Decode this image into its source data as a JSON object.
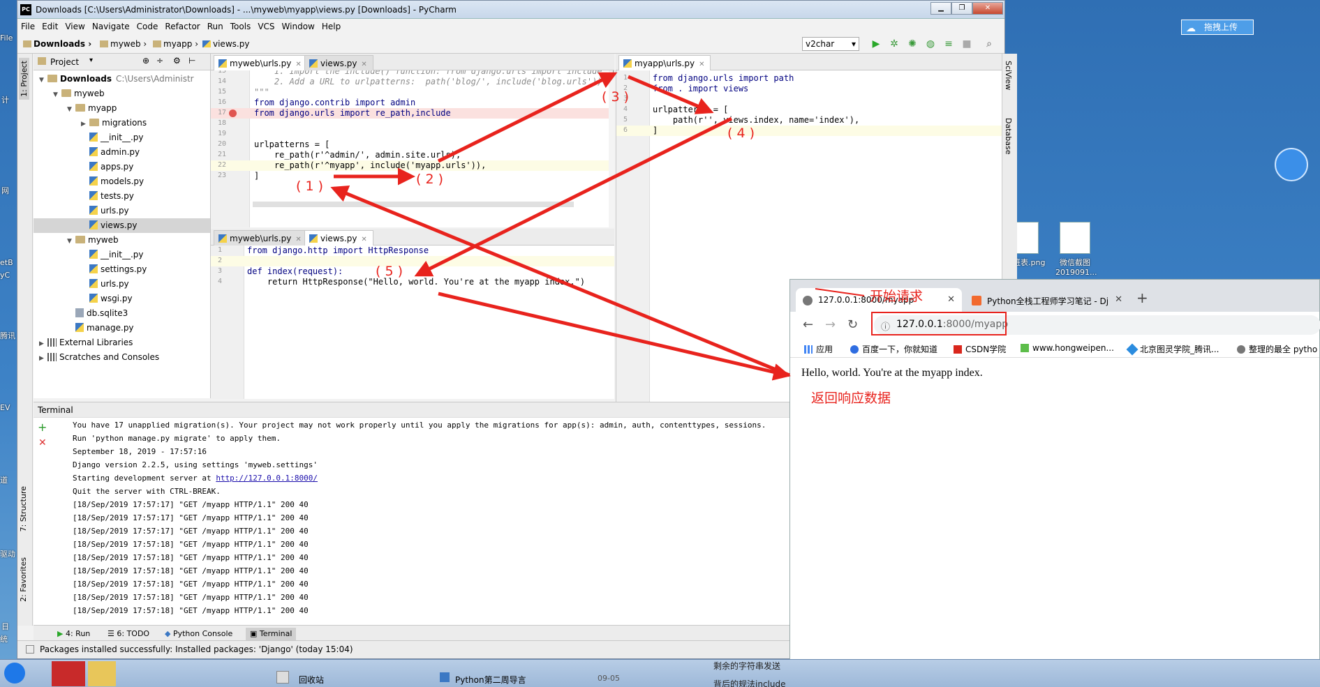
{
  "window": {
    "title": "Downloads [C:\\Users\\Administrator\\Downloads] - ...\\myweb\\myapp\\views.py [Downloads] - PyCharm",
    "logo": "PC"
  },
  "menu": [
    "File",
    "Edit",
    "View",
    "Navigate",
    "Code",
    "Refactor",
    "Run",
    "Tools",
    "VCS",
    "Window",
    "Help"
  ],
  "breadcrumbs": [
    "Downloads",
    "myweb",
    "myapp",
    "views.py"
  ],
  "run_config": "v2char",
  "left_strip": [
    "1: Project",
    "7: Structure",
    "2: Favorites"
  ],
  "project": {
    "header": "Project",
    "tree": [
      {
        "label": "Downloads",
        "extra": "C:\\Users\\Administr",
        "kind": "folder",
        "depth": 0,
        "arrow": "▼"
      },
      {
        "label": "myweb",
        "kind": "folder",
        "depth": 1,
        "arrow": "▼"
      },
      {
        "label": "myapp",
        "kind": "folder",
        "depth": 2,
        "arrow": "▼"
      },
      {
        "label": "migrations",
        "kind": "folder",
        "depth": 3,
        "arrow": "▶"
      },
      {
        "label": "__init__.py",
        "kind": "py",
        "depth": 3
      },
      {
        "label": "admin.py",
        "kind": "py",
        "depth": 3
      },
      {
        "label": "apps.py",
        "kind": "py",
        "depth": 3
      },
      {
        "label": "models.py",
        "kind": "py",
        "depth": 3
      },
      {
        "label": "tests.py",
        "kind": "py",
        "depth": 3
      },
      {
        "label": "urls.py",
        "kind": "py",
        "depth": 3
      },
      {
        "label": "views.py",
        "kind": "py",
        "depth": 3,
        "selected": true
      },
      {
        "label": "myweb",
        "kind": "folder",
        "depth": 2,
        "arrow": "▼"
      },
      {
        "label": "__init__.py",
        "kind": "py",
        "depth": 3
      },
      {
        "label": "settings.py",
        "kind": "py",
        "depth": 3
      },
      {
        "label": "urls.py",
        "kind": "py",
        "depth": 3
      },
      {
        "label": "wsgi.py",
        "kind": "py",
        "depth": 3
      },
      {
        "label": "db.sqlite3",
        "kind": "db",
        "depth": 2
      },
      {
        "label": "manage.py",
        "kind": "py",
        "depth": 2
      },
      {
        "label": "External Libraries",
        "kind": "lib",
        "depth": 0,
        "arrow": "▶"
      },
      {
        "label": "Scratches and Consoles",
        "kind": "lib",
        "depth": 0,
        "arrow": "▶"
      }
    ]
  },
  "editor_top": {
    "tabs": [
      "myweb\\urls.py",
      "views.py"
    ],
    "lines": [
      {
        "n": "13",
        "t": "    1. Import the include() function: from django.urls import include, pa",
        "c": "cmt"
      },
      {
        "n": "14",
        "t": "    2. Add a URL to urlpatterns:  path('blog/', include('blog.urls'))",
        "c": "cmt"
      },
      {
        "n": "15",
        "t": "\"\"\"",
        "c": "cmt"
      },
      {
        "n": "16",
        "t": "from django.contrib import admin",
        "c": "kw"
      },
      {
        "n": "17",
        "t": "from django.urls import re_path,include",
        "c": "kw"
      },
      {
        "n": "18",
        "t": "",
        "c": ""
      },
      {
        "n": "19",
        "t": "",
        "c": ""
      },
      {
        "n": "20",
        "t": "urlpatterns = [",
        "c": ""
      },
      {
        "n": "21",
        "t": "    re_path(r'^admin/', admin.site.urls),",
        "c": ""
      },
      {
        "n": "22",
        "t": "    re_path(r'^myapp', include('myapp.urls')),",
        "c": ""
      },
      {
        "n": "23",
        "t": "]",
        "c": ""
      }
    ]
  },
  "editor_bottom": {
    "tabs": [
      "myweb\\urls.py",
      "views.py"
    ],
    "lines": [
      {
        "n": "1",
        "t": "from django.http import HttpResponse",
        "c": "kw"
      },
      {
        "n": "2",
        "t": "",
        "c": ""
      },
      {
        "n": "3",
        "t": "def index(request):",
        "c": "kw"
      },
      {
        "n": "4",
        "t": "    return HttpResponse(\"Hello, world. You're at the myapp index.\")",
        "c": ""
      }
    ]
  },
  "editor_right": {
    "tabs": [
      "myapp\\urls.py"
    ],
    "lines": [
      {
        "n": "1",
        "t": "from django.urls import path",
        "c": "kw"
      },
      {
        "n": "2",
        "t": "from . import views",
        "c": "kw"
      },
      {
        "n": "3",
        "t": "",
        "c": ""
      },
      {
        "n": "4",
        "t": "urlpatterns = [",
        "c": ""
      },
      {
        "n": "5",
        "t": "    path(r'', views.index, name='index'),",
        "c": ""
      },
      {
        "n": "6",
        "t": "]",
        "c": ""
      }
    ]
  },
  "right_strip": [
    "SciView",
    "Database"
  ],
  "terminal": {
    "title": "Terminal",
    "lines": [
      "You have 17 unapplied migration(s). Your project may not work properly until you apply the migrations for app(s): admin, auth, contenttypes, sessions.",
      "Run 'python manage.py migrate' to apply them.",
      "September 18, 2019 - 17:57:16",
      "Django version 2.2.5, using settings 'myweb.settings'",
      "Starting development server at ",
      "Quit the server with CTRL-BREAK.",
      "[18/Sep/2019 17:57:17] \"GET /myapp HTTP/1.1\" 200 40",
      "[18/Sep/2019 17:57:17] \"GET /myapp HTTP/1.1\" 200 40",
      "[18/Sep/2019 17:57:17] \"GET /myapp HTTP/1.1\" 200 40",
      "[18/Sep/2019 17:57:18] \"GET /myapp HTTP/1.1\" 200 40",
      "[18/Sep/2019 17:57:18] \"GET /myapp HTTP/1.1\" 200 40",
      "[18/Sep/2019 17:57:18] \"GET /myapp HTTP/1.1\" 200 40",
      "[18/Sep/2019 17:57:18] \"GET /myapp HTTP/1.1\" 200 40",
      "[18/Sep/2019 17:57:18] \"GET /myapp HTTP/1.1\" 200 40",
      "[18/Sep/2019 17:57:18] \"GET /myapp HTTP/1.1\" 200 40"
    ],
    "server_url": "http://127.0.0.1:8000/"
  },
  "bottom_tabs": [
    "4: Run",
    "6: TODO",
    "Python Console",
    "Terminal"
  ],
  "status": "Packages installed successfully: Installed packages: 'Django' (today 15:04)",
  "browser": {
    "tabs": [
      {
        "label": "127.0.0.1:8000/myapp"
      },
      {
        "label": "Python全栈工程师学习笔记 - Dj"
      }
    ],
    "url_host": "127.0.0.1",
    "url_rest": ":8000/myapp",
    "bookmarks": [
      "应用",
      "百度一下，你就知道",
      "CSDN学院",
      "www.hongweipen...",
      "北京图灵学院_腾讯...",
      "整理的最全 pytho"
    ],
    "body_text": "Hello, world. You're at the myapp index."
  },
  "annotations": {
    "n1": "( 1 )",
    "n2": "( 2 )",
    "n3": "( 3 )",
    "n4": "( 4 )",
    "n5": "( 5 )",
    "start": "开始请求",
    "return": "返回响应数据"
  },
  "desktop": {
    "upload_button": "拖拽上传",
    "icon1_label": "上班表.png",
    "icon2_label1": "微信截图",
    "icon2_label2": "2019091...",
    "left_labels": [
      "File",
      "计",
      "网",
      "etB",
      "yC",
      "腾讯",
      "EV",
      "道",
      "驱动",
      "日",
      "统"
    ],
    "taskbar_items": [
      "回收站",
      "Python第二周导言",
      "09-05",
      "剩余的字符串发送",
      "背后的规法include"
    ]
  },
  "colors": {
    "annotation": "#e8231d",
    "link": "#1a0dab"
  }
}
